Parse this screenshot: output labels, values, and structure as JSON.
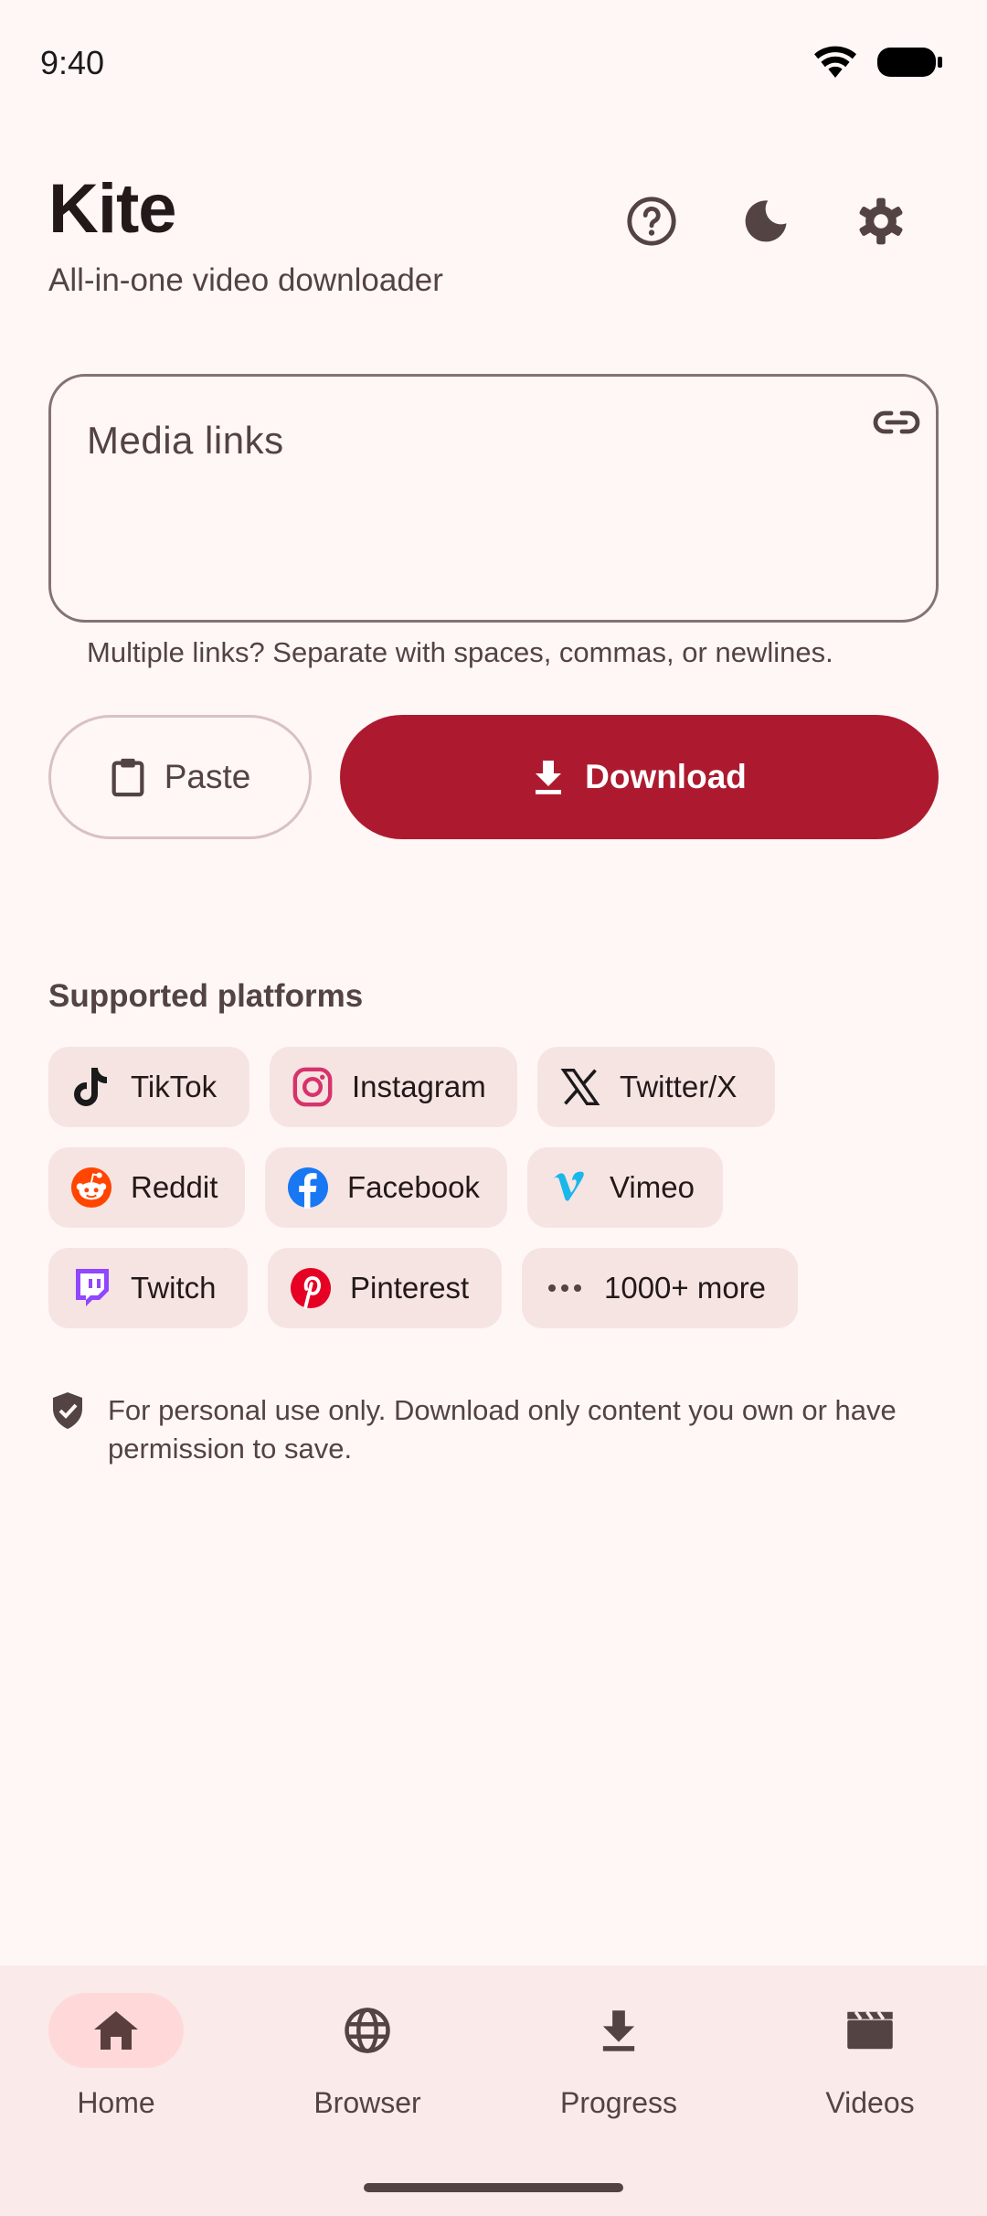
{
  "status_bar": {
    "time": "9:40"
  },
  "header": {
    "title": "Kite",
    "subtitle": "All-in-one video downloader",
    "icons": [
      "help-icon",
      "dark-mode-icon",
      "settings-icon"
    ]
  },
  "input": {
    "placeholder": "Media links",
    "helper": "Multiple links? Separate with spaces, commas, or newlines."
  },
  "actions": {
    "paste_label": "Paste",
    "download_label": "Download"
  },
  "platforms": {
    "title": "Supported platforms",
    "items": [
      {
        "label": "TikTok",
        "icon": "tiktok-icon"
      },
      {
        "label": "Instagram",
        "icon": "instagram-icon"
      },
      {
        "label": "Twitter/X",
        "icon": "x-icon"
      },
      {
        "label": "Reddit",
        "icon": "reddit-icon"
      },
      {
        "label": "Facebook",
        "icon": "facebook-icon"
      },
      {
        "label": "Vimeo",
        "icon": "vimeo-icon"
      },
      {
        "label": "Twitch",
        "icon": "twitch-icon"
      },
      {
        "label": "Pinterest",
        "icon": "pinterest-icon"
      },
      {
        "label": "1000+ more",
        "icon": "more-icon"
      }
    ]
  },
  "disclaimer": "For personal use only. Download only content you own or have permission to save.",
  "nav": {
    "items": [
      {
        "label": "Home",
        "icon": "home-icon",
        "active": true
      },
      {
        "label": "Browser",
        "icon": "globe-icon",
        "active": false
      },
      {
        "label": "Progress",
        "icon": "download-icon",
        "active": false
      },
      {
        "label": "Videos",
        "icon": "clapperboard-icon",
        "active": false
      }
    ]
  },
  "colors": {
    "background": "#FFF7F6",
    "primary": "#AD1A2F",
    "chip": "#F6E4E3",
    "nav_background": "#FAEAEA",
    "nav_active": "#FFD9DA"
  }
}
